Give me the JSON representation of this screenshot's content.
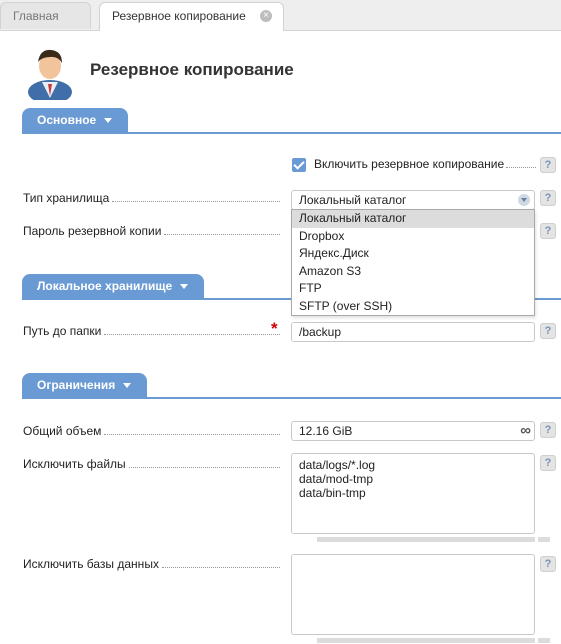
{
  "tabs": [
    {
      "label": "Главная"
    },
    {
      "label": "Резервное копирование"
    }
  ],
  "page": {
    "title": "Резервное копирование"
  },
  "sections": {
    "main": {
      "title": "Основное"
    },
    "local": {
      "title": "Локальное хранилище"
    },
    "limits": {
      "title": "Ограничения"
    }
  },
  "form": {
    "enable_backup": {
      "label": "Включить резервное копирование",
      "checked": true
    },
    "storage_type": {
      "label": "Тип хранилища",
      "value": "Локальный каталог",
      "options": [
        "Локальный каталог",
        "Dropbox",
        "Яндекс.Диск",
        "Amazon S3",
        "FTP",
        "SFTP (over SSH)"
      ]
    },
    "backup_password": {
      "label": "Пароль резервной копии"
    },
    "folder_path": {
      "label": "Путь до папки",
      "value": "/backup",
      "required_mark": "*"
    },
    "total_volume": {
      "label": "Общий объем",
      "value": "12.16 GiB",
      "unit_icon": "∞"
    },
    "exclude_files": {
      "label": "Исключить файлы",
      "value": "data/logs/*.log\ndata/mod-tmp\ndata/bin-tmp"
    },
    "exclude_db": {
      "label": "Исключить базы данных",
      "value": ""
    }
  },
  "help_symbol": "?",
  "colors": {
    "accent": "#6a9ad3",
    "required": "#d40000"
  }
}
